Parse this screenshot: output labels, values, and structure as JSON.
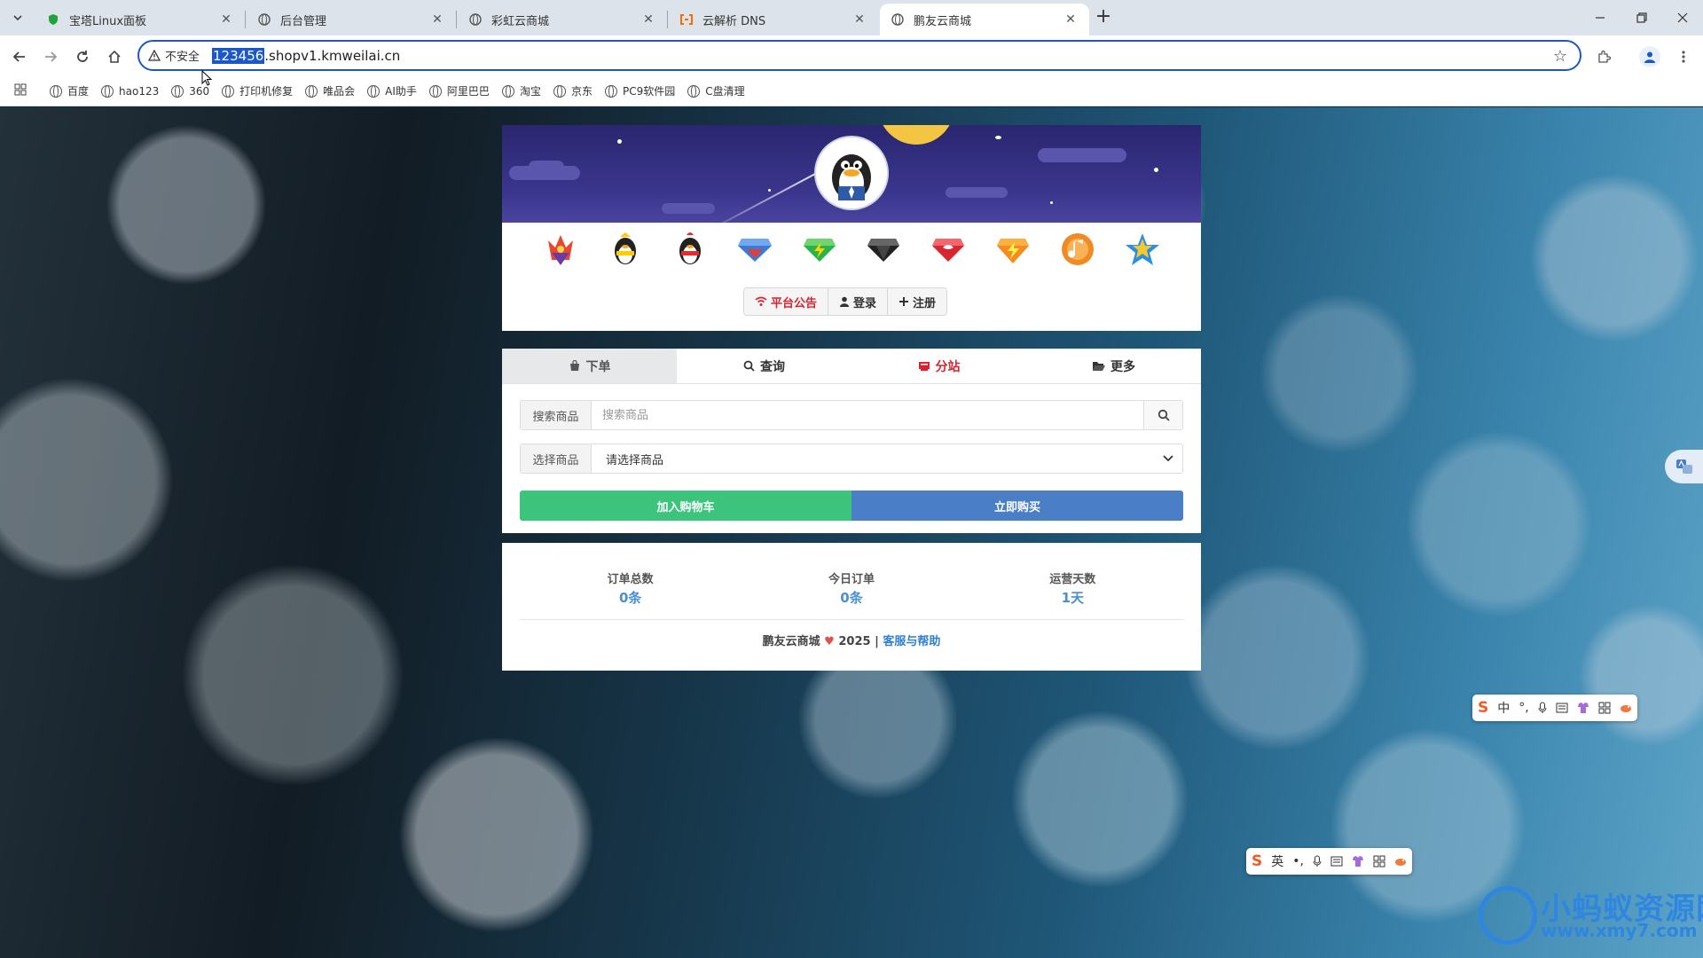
{
  "browser": {
    "tabs": [
      {
        "title": "宝塔Linux面板",
        "favicon": "shield-icon"
      },
      {
        "title": "后台管理",
        "favicon": "globe-icon"
      },
      {
        "title": "彩虹云商城",
        "favicon": "globe-icon"
      },
      {
        "title": "云解析 DNS",
        "favicon": "aliyun-icon"
      },
      {
        "title": "鹏友云商城",
        "favicon": "globe-icon",
        "active": true
      }
    ],
    "address": {
      "security_label": "不安全",
      "url_selected": "123456",
      "url_rest": ".shopv1.kmweilai.cn"
    },
    "bookmarks": [
      "百度",
      "hao123",
      "360",
      "打印机修复",
      "唯品会",
      "AI助手",
      "阿里巴巴",
      "淘宝",
      "京东",
      "PC9软件园",
      "C盘清理"
    ],
    "accent_color": "#1a57c8"
  },
  "site": {
    "header_buttons": {
      "notice": "平台公告",
      "login": "登录",
      "register": "注册"
    },
    "vip_icons": [
      "vip-crown-icon",
      "qq-yellow-penguin-icon",
      "qq-red-penguin-icon",
      "blue-diamond-icon",
      "green-diamond-icon",
      "black-diamond-icon",
      "red-diamond-icon",
      "orange-lightning-icon",
      "music-note-icon",
      "blue-star-icon"
    ],
    "tabs": {
      "order": "下单",
      "query": "查询",
      "substation": "分站",
      "more": "更多"
    },
    "search": {
      "label": "搜索商品",
      "placeholder": "搜索商品"
    },
    "select": {
      "label": "选择商品",
      "value": "请选择商品"
    },
    "actions": {
      "add_cart": "加入购物车",
      "buy_now": "立即购买"
    },
    "stats": [
      {
        "label": "订单总数",
        "value": "0条"
      },
      {
        "label": "今日订单",
        "value": "0条"
      },
      {
        "label": "运营天数",
        "value": "1天"
      }
    ],
    "footer": {
      "brand": "鹏友云商城",
      "year": "2025",
      "separator": "|",
      "help": "客服与帮助"
    },
    "colors": {
      "cart_green": "#3cc47c",
      "buy_blue": "#4a7fc7",
      "red": "#d9232d",
      "stat_blue": "#4a8fd6"
    }
  },
  "ime": {
    "bar1_lang": "中",
    "bar2_lang": "英"
  },
  "watermark": {
    "title": "小蚂蚁资源网",
    "url": "www.xmy7.com"
  }
}
